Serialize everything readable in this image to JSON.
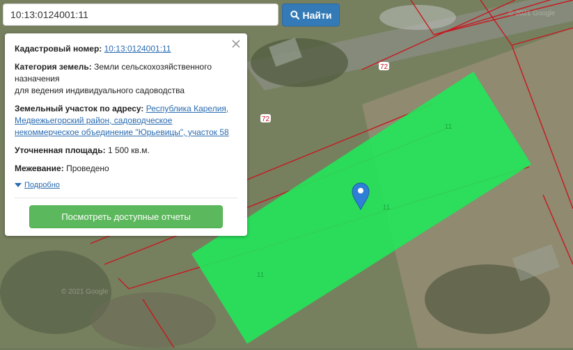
{
  "search": {
    "value": "10:13:0124001:11",
    "button_label": "Найти"
  },
  "panel": {
    "cadastral_label": "Кадастровый номер:",
    "cadastral_value": "10:13:0124001:11",
    "category_label": "Категория земель:",
    "category_value_1": "Земли сельскохозяйственного",
    "category_value_2": "назначения",
    "category_value_3": "для ведения индивидуального садоводства",
    "address_label": "Земельный участок по адресу:",
    "address_value_1": "Республика Карелия,",
    "address_value_2": "Медвежьегорский район, садоводческое",
    "address_value_3": "некоммерческое объединение \"Юрьевицы\", участок 58",
    "area_label": "Уточненная площадь:",
    "area_value": "1 500 кв.м.",
    "survey_label": "Межевание:",
    "survey_value": "Проведено",
    "details_link": "Подробно",
    "reports_button": "Посмотреть доступные отчеты"
  },
  "map": {
    "parcel_labels": [
      "72",
      "72",
      "11",
      "11",
      "11"
    ],
    "watermarks": [
      "© 2021 Google",
      "© 2021 Google"
    ],
    "colors": {
      "highlight": "#22e65a",
      "boundary": "#c8171f",
      "marker": "#2f7fd6",
      "button_blue": "#337ab7",
      "button_green": "#5cb85c",
      "link": "#2a6bb0"
    },
    "icons": [
      "search-icon",
      "close-icon",
      "map-marker-icon",
      "caret-down-icon"
    ]
  }
}
